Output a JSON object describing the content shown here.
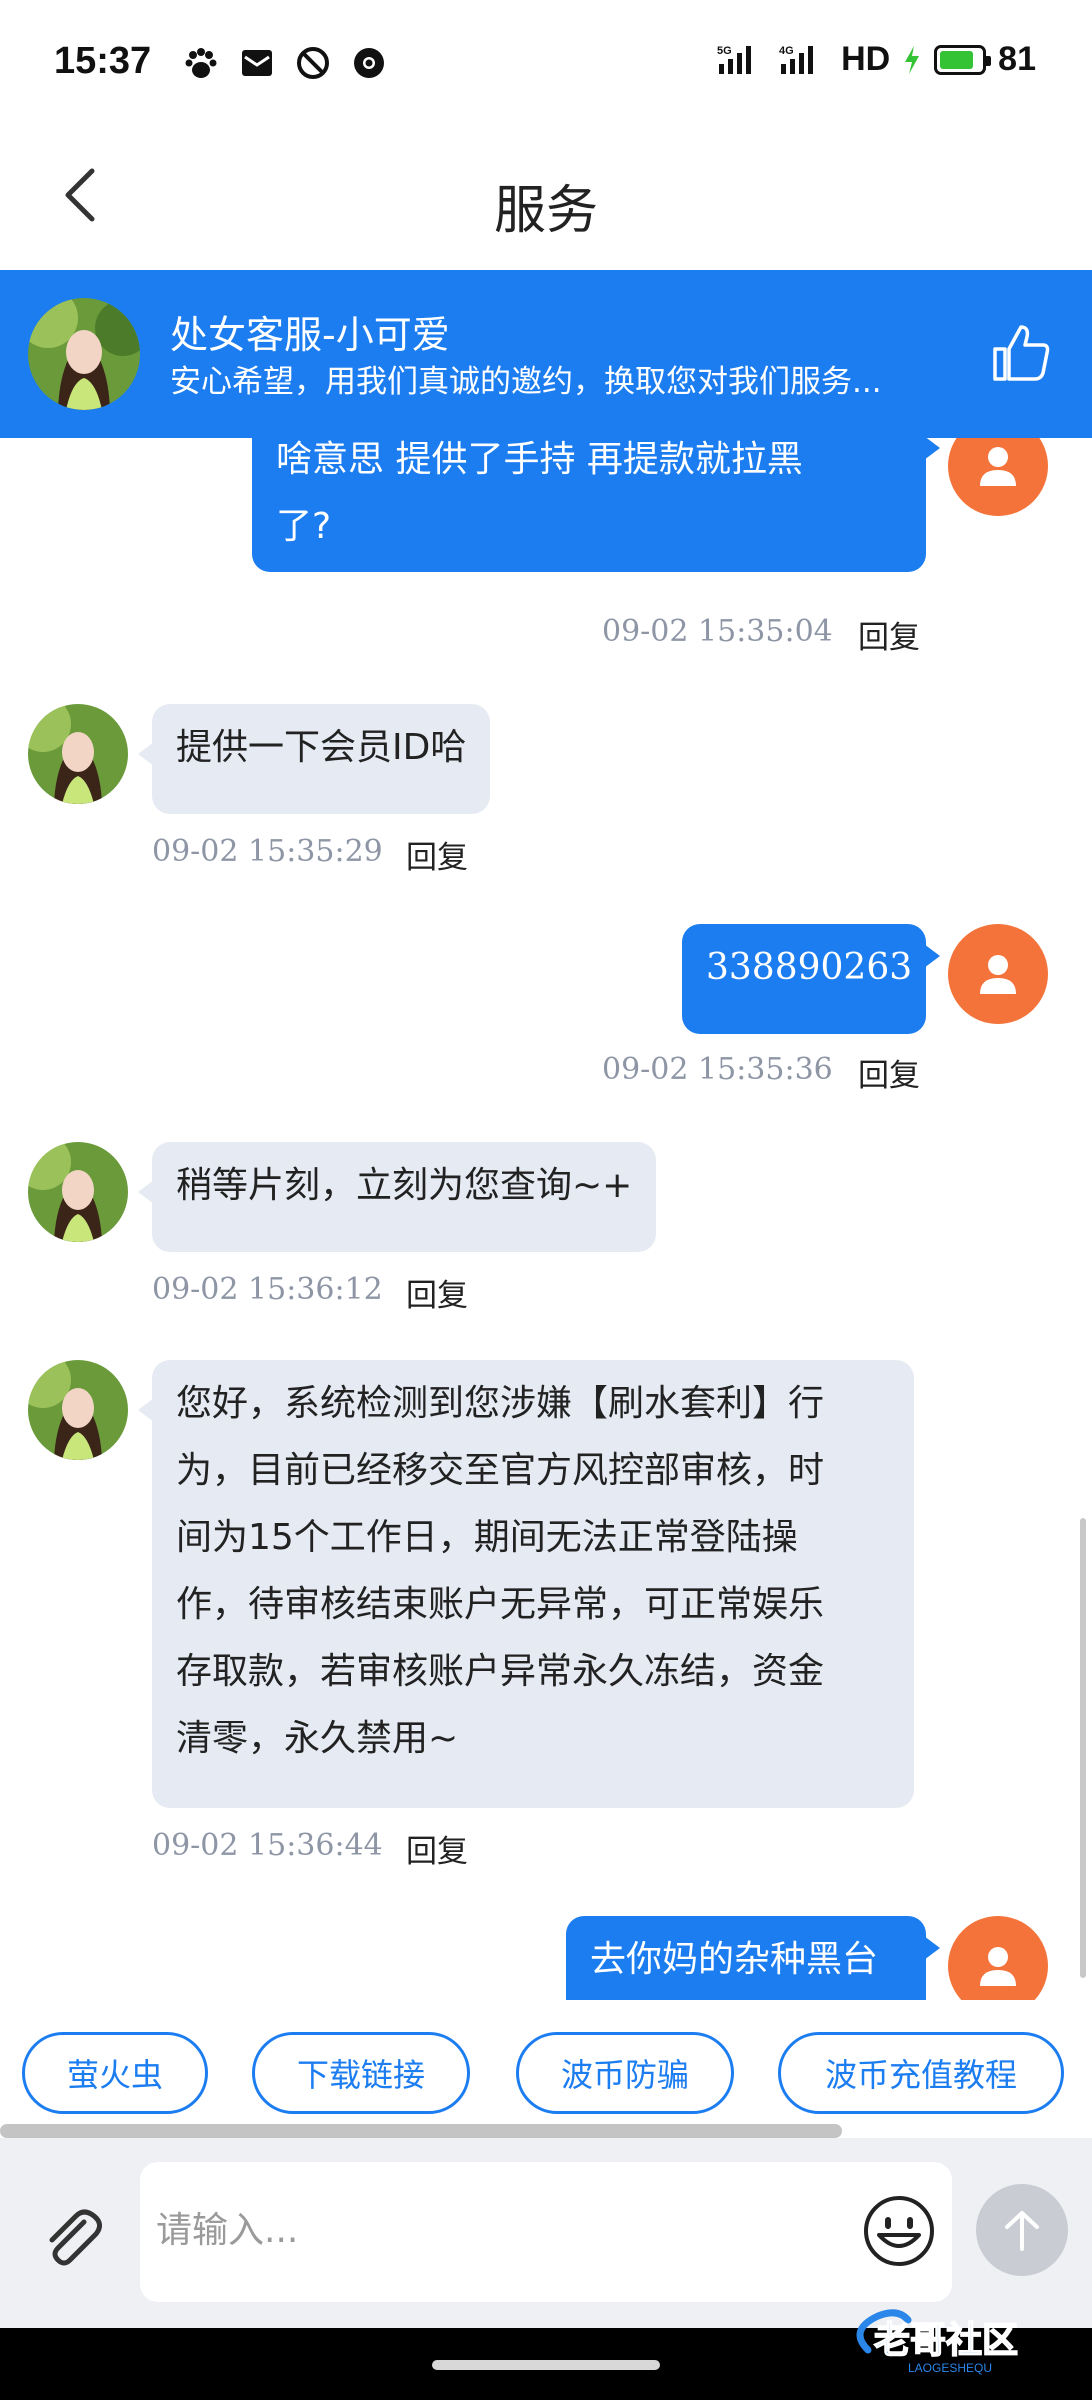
{
  "status_bar": {
    "time": "15:37",
    "network1": "5G",
    "network2": "4G",
    "hd": "HD",
    "battery": "81",
    "battery_level": 0.81
  },
  "header": {
    "title": "服务"
  },
  "agent": {
    "name": "处女客服-小可爱",
    "description": "安心希望，用我们真诚的邀约，换取您对我们服务..."
  },
  "reply_label": "回复",
  "messages": [
    {
      "side": "out",
      "text": "啥意思 提供了手持 再提款就拉黑了?",
      "line1": "啥意思 提供了手持 再提款就拉黑",
      "line2": "了?",
      "time": "09-02 15:35:04"
    },
    {
      "side": "in",
      "text": "提供一下会员ID哈",
      "time": "09-02 15:35:29"
    },
    {
      "side": "out",
      "text": "338890263",
      "time": "09-02 15:35:36"
    },
    {
      "side": "in",
      "text": "稍等片刻，立刻为您查询~+",
      "time": "09-02 15:36:12"
    },
    {
      "side": "in",
      "lines": [
        "您好，系统检测到您涉嫌【刷水套利】行",
        "为，目前已经移交至官方风控部审核，时",
        "间为15个工作日，期间无法正常登陆操",
        "作，待审核结束账户无异常，可正常娱乐",
        "存取款，若审核账户异常永久冻结，资金",
        "清零，永久禁用~"
      ],
      "time": "09-02 15:36:44"
    },
    {
      "side": "out",
      "text": "去你妈的杂种黑台",
      "time": ""
    }
  ],
  "quick_links": [
    "萤火虫",
    "下载链接",
    "波币防骗",
    "波币充值教程"
  ],
  "input": {
    "placeholder": "请输入..."
  },
  "watermark": {
    "text": "老哥社区",
    "sub": "LAOGESHEQU"
  },
  "colors": {
    "accent": "#1c7df1",
    "user_avatar": "#f4733b",
    "incoming_bubble": "#e5eaf3"
  }
}
